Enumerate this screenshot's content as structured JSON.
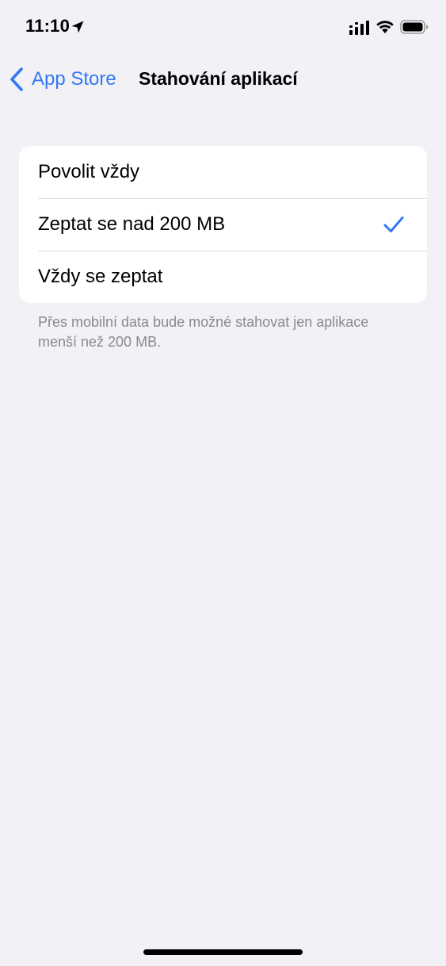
{
  "status_bar": {
    "time": "11:10"
  },
  "nav": {
    "back_label": "App Store",
    "title": "Stahování aplikací"
  },
  "options": [
    {
      "label": "Povolit vždy",
      "selected": false
    },
    {
      "label": "Zeptat se nad 200 MB",
      "selected": true
    },
    {
      "label": "Vždy se zeptat",
      "selected": false
    }
  ],
  "footer_note": "Přes mobilní data bude možné stahovat jen aplikace menší než 200 MB.",
  "colors": {
    "accent": "#3478f6",
    "background": "#f1f1f6",
    "card": "#ffffff",
    "secondary_text": "#8a8a8e"
  },
  "icons": [
    "location-arrow-icon",
    "cellular-signal-icon",
    "wifi-icon",
    "battery-icon",
    "chevron-left-icon",
    "checkmark-icon"
  ]
}
